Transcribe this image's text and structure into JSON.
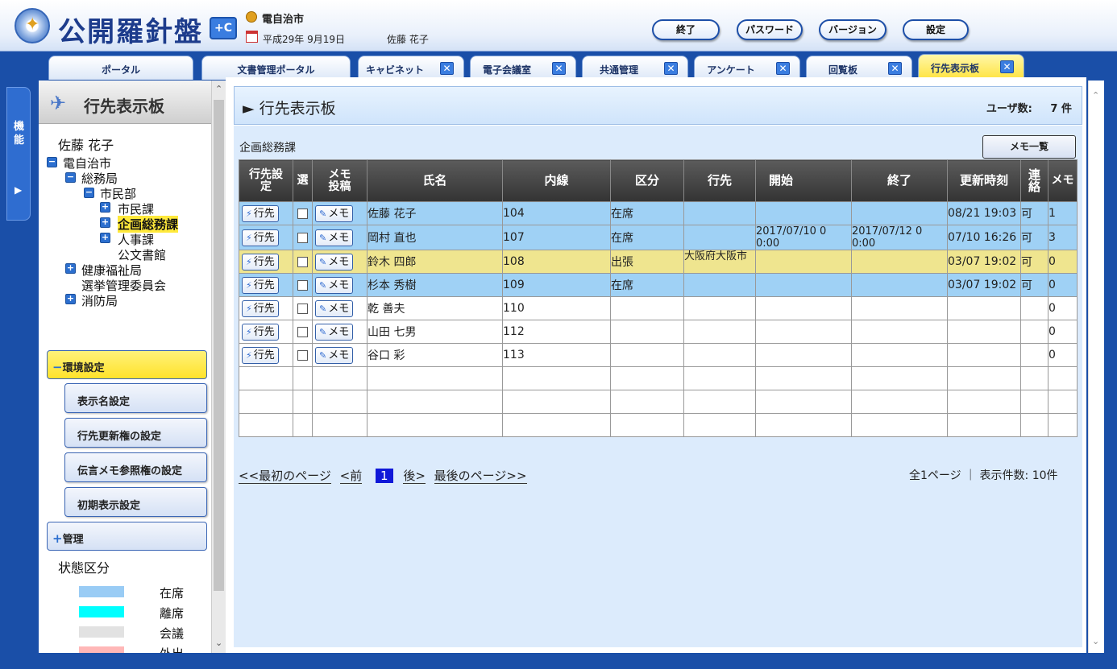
{
  "header": {
    "app_name": "公開羅針盤",
    "badge": "+C",
    "org": "電自治市",
    "date": "平成29年 9月19日",
    "user": "佐藤 花子",
    "buttons": [
      "終了",
      "パスワード",
      "バージョン",
      "設定"
    ]
  },
  "tabs": [
    {
      "label": "ポータル"
    },
    {
      "label": "文書管理ポータル"
    },
    {
      "label": "キャビネット",
      "close": "✕"
    },
    {
      "label": "電子会議室",
      "close": "✕"
    },
    {
      "label": "共通管理",
      "close": "✕"
    },
    {
      "label": "アンケート",
      "close": "✕"
    },
    {
      "label": "回覧板",
      "close": "✕"
    },
    {
      "label": "行先表示板",
      "close": "✕"
    }
  ],
  "left_tab": {
    "label": "機能",
    "arrow": "▶"
  },
  "sidebar": {
    "title": "行先表示板",
    "user": "佐藤 花子",
    "tree": [
      "電自治市",
      "総務局",
      "市民部",
      "市民課",
      "企画総務課",
      "人事課",
      "公文書館",
      "健康福祉局",
      "選挙管理委員会",
      "消防局"
    ],
    "tree_toggles": {
      "minus": "−",
      "plus": "+"
    },
    "env_settings": "環境設定",
    "env_items": [
      "表示名設定",
      "行先更新権の設定",
      "伝言メモ参照権の設定",
      "初期表示設定"
    ],
    "admin": "管理",
    "status_label": "状態区分",
    "legend": [
      {
        "label": "在席",
        "color": "#99ccf5"
      },
      {
        "label": "離席",
        "color": "#00ffff"
      },
      {
        "label": "会議",
        "color": "#e2e2e2"
      },
      {
        "label": "外出",
        "color": "#ffb7b7"
      }
    ]
  },
  "main": {
    "title": "行先表示板",
    "user_count_label": "ユーザ数:",
    "user_count": "7 件",
    "dept": "企画総務課",
    "memo_list_button": "メモ一覧",
    "columns": [
      "行先設定",
      "選",
      "メモ投稿",
      "氏名",
      "内線",
      "区分",
      "行先",
      "開始",
      "終了",
      "更新時刻",
      "連絡",
      "メモ"
    ],
    "btn_goto": "行先",
    "btn_memo": "メモ",
    "rows": [
      {
        "name": "佐藤 花子",
        "ext": "104",
        "status": "在席",
        "dest": "",
        "start": "",
        "end": "",
        "updated": "08/21 19:03",
        "contact": "可",
        "memo": "1",
        "color": "blue"
      },
      {
        "name": "岡村 直也",
        "ext": "107",
        "status": "在席",
        "dest": "",
        "start": "2017/07/10 0 0:00",
        "end": "2017/07/12 0 0:00",
        "updated": "07/10 16:26",
        "contact": "可",
        "memo": "3",
        "color": "blue"
      },
      {
        "name": "鈴木 四郎",
        "ext": "108",
        "status": "出張",
        "dest": "大阪府大阪市",
        "start": "",
        "end": "",
        "updated": "03/07 19:02",
        "contact": "可",
        "memo": "0",
        "color": "yellow"
      },
      {
        "name": "杉本 秀樹",
        "ext": "109",
        "status": "在席",
        "dest": "",
        "start": "",
        "end": "",
        "updated": "03/07 19:02",
        "contact": "可",
        "memo": "0",
        "color": "blue"
      },
      {
        "name": "乾 善夫",
        "ext": "110",
        "status": "",
        "dest": "",
        "start": "",
        "end": "",
        "updated": "",
        "contact": "",
        "memo": "0",
        "color": "white"
      },
      {
        "name": "山田 七男",
        "ext": "112",
        "status": "",
        "dest": "",
        "start": "",
        "end": "",
        "updated": "",
        "contact": "",
        "memo": "0",
        "color": "white"
      },
      {
        "name": "谷口 彩",
        "ext": "113",
        "status": "",
        "dest": "",
        "start": "",
        "end": "",
        "updated": "",
        "contact": "",
        "memo": "0",
        "color": "white"
      }
    ],
    "empty_rows": 3,
    "pager": {
      "first": "<<最初のページ",
      "prev": "<前",
      "current": "1",
      "next": "後>",
      "last": "最後のページ>>",
      "info": "全1ページ ｜ 表示件数: 10件"
    }
  },
  "icons": {
    "logo": "compass-icon",
    "user": "user-icon",
    "calendar": "calendar-icon",
    "sidebar_title": "plane-icon",
    "goto": "lightning-icon",
    "memo": "pencil-icon"
  }
}
